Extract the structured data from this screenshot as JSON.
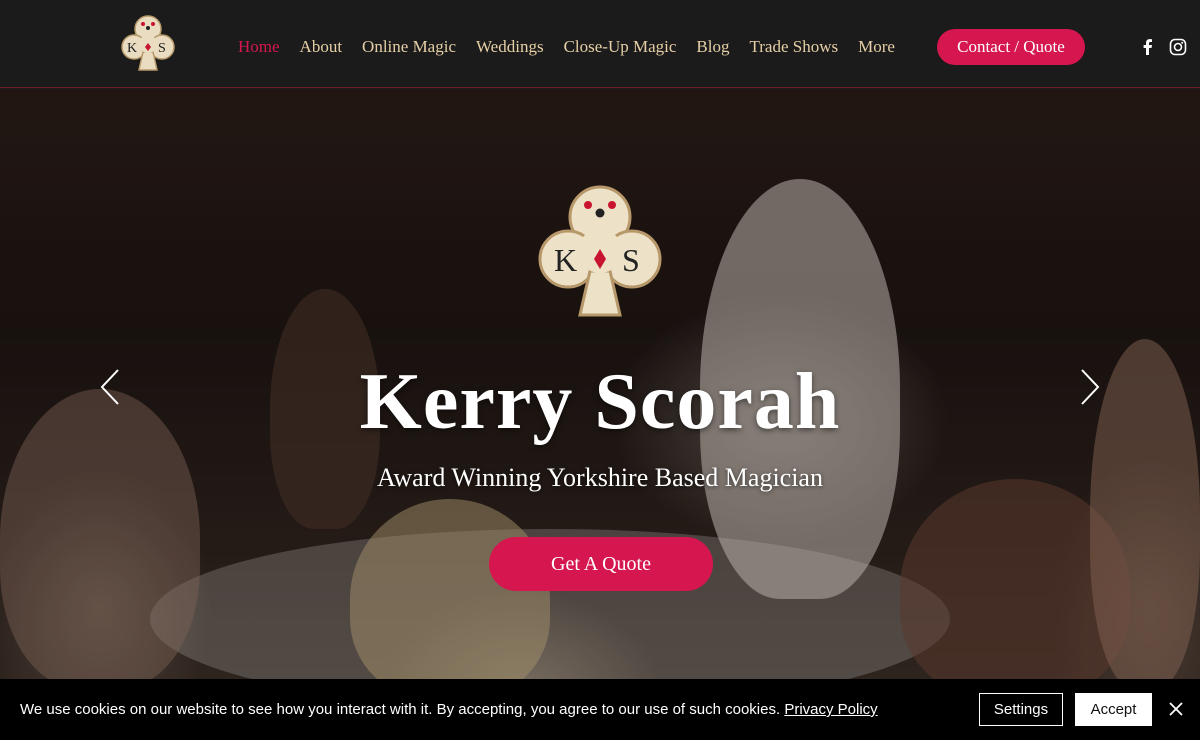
{
  "brand": {
    "logo_letters": "K S",
    "colors": {
      "accent": "#d5164f",
      "nav_text": "#e6cfa6",
      "header_bg": "#1b1b1b"
    }
  },
  "nav": {
    "items": [
      {
        "label": "Home",
        "active": true
      },
      {
        "label": "About"
      },
      {
        "label": "Online Magic"
      },
      {
        "label": "Weddings"
      },
      {
        "label": "Close-Up Magic"
      },
      {
        "label": "Blog"
      },
      {
        "label": "Trade Shows"
      },
      {
        "label": "More"
      }
    ],
    "cta_label": "Contact / Quote",
    "social": [
      "facebook-icon",
      "instagram-icon"
    ]
  },
  "hero": {
    "title": "Kerry Scorah",
    "subtitle": "Award Winning Yorkshire Based Magician",
    "button_label": "Get A Quote"
  },
  "cookie": {
    "message": "We use cookies on our website to see how you interact with it. By accepting, you agree to our use of such cookies.",
    "policy_link": "Privacy Policy",
    "settings_label": "Settings",
    "accept_label": "Accept"
  }
}
